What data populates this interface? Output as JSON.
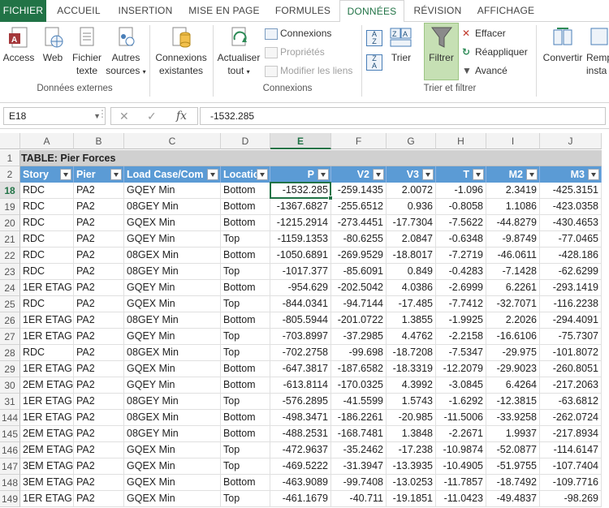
{
  "tabs": [
    "FICHIER",
    "ACCUEIL",
    "INSERTION",
    "MISE EN PAGE",
    "FORMULES",
    "DONNÉES",
    "RÉVISION",
    "AFFICHAGE"
  ],
  "ribbon": {
    "access": "Access",
    "web": "Web",
    "fichier_texte_1": "Fichier",
    "fichier_texte_2": "texte",
    "autres_sources_1": "Autres",
    "autres_sources_2": "sources",
    "group_donnees_externes": "Données externes",
    "connexions_existantes_1": "Connexions",
    "connexions_existantes_2": "existantes",
    "actualiser_1": "Actualiser",
    "actualiser_2": "tout",
    "connexions": "Connexions",
    "proprietes": "Propriétés",
    "modifier_liens": "Modifier les liens",
    "group_connexions": "Connexions",
    "trier": "Trier",
    "filtrer": "Filtrer",
    "effacer": "Effacer",
    "reappliquer": "Réappliquer",
    "avance": "Avancé",
    "group_trier_filtrer": "Trier et filtrer",
    "convertir": "Convertir",
    "remplissage_1": "Remp",
    "remplissage_2": "insta"
  },
  "formula_bar": {
    "name_box": "E18",
    "formula": "-1532.285"
  },
  "columns": [
    "A",
    "B",
    "C",
    "D",
    "E",
    "F",
    "G",
    "H",
    "I",
    "J"
  ],
  "table_title": "TABLE:  Pier Forces",
  "table_headers": [
    "Story",
    "Pier",
    "Load Case/Com",
    "Locatio",
    "P",
    "V2",
    "V3",
    "T",
    "M2",
    "M3"
  ],
  "rows": [
    {
      "n": "1"
    },
    {
      "n": "2"
    },
    {
      "n": "18",
      "cells": [
        "RDC",
        "PA2",
        "GQEY Min",
        "Bottom",
        "-1532.285",
        "-259.1435",
        "2.0072",
        "-1.096",
        "2.3419",
        "-425.3151"
      ]
    },
    {
      "n": "19",
      "cells": [
        "RDC",
        "PA2",
        "08GEY Min",
        "Bottom",
        "-1367.6827",
        "-255.6512",
        "0.936",
        "-0.8058",
        "1.1086",
        "-423.0358"
      ]
    },
    {
      "n": "20",
      "cells": [
        "RDC",
        "PA2",
        "GQEX Min",
        "Bottom",
        "-1215.2914",
        "-273.4451",
        "-17.7304",
        "-7.5622",
        "-44.8279",
        "-430.4653"
      ]
    },
    {
      "n": "21",
      "cells": [
        "RDC",
        "PA2",
        "GQEY Min",
        "Top",
        "-1159.1353",
        "-80.6255",
        "2.0847",
        "-0.6348",
        "-9.8749",
        "-77.0465"
      ]
    },
    {
      "n": "22",
      "cells": [
        "RDC",
        "PA2",
        "08GEX Min",
        "Bottom",
        "-1050.6891",
        "-269.9529",
        "-18.8017",
        "-7.2719",
        "-46.0611",
        "-428.186"
      ]
    },
    {
      "n": "23",
      "cells": [
        "RDC",
        "PA2",
        "08GEY Min",
        "Top",
        "-1017.377",
        "-85.6091",
        "0.849",
        "-0.4283",
        "-7.1428",
        "-62.6299"
      ]
    },
    {
      "n": "24",
      "cells": [
        "1ER ETAG",
        "PA2",
        "GQEY Min",
        "Bottom",
        "-954.629",
        "-202.5042",
        "4.0386",
        "-2.6999",
        "6.2261",
        "-293.1419"
      ]
    },
    {
      "n": "25",
      "cells": [
        "RDC",
        "PA2",
        "GQEX Min",
        "Top",
        "-844.0341",
        "-94.7144",
        "-17.485",
        "-7.7412",
        "-32.7071",
        "-116.2238"
      ]
    },
    {
      "n": "26",
      "cells": [
        "1ER ETAG",
        "PA2",
        "08GEY Min",
        "Bottom",
        "-805.5944",
        "-201.0722",
        "1.3855",
        "-1.9925",
        "2.2026",
        "-294.4091"
      ]
    },
    {
      "n": "27",
      "cells": [
        "1ER ETAG",
        "PA2",
        "GQEY Min",
        "Top",
        "-703.8997",
        "-37.2985",
        "4.4762",
        "-2.2158",
        "-16.6106",
        "-75.7307"
      ]
    },
    {
      "n": "28",
      "cells": [
        "RDC",
        "PA2",
        "08GEX Min",
        "Top",
        "-702.2758",
        "-99.698",
        "-18.7208",
        "-7.5347",
        "-29.975",
        "-101.8072"
      ]
    },
    {
      "n": "29",
      "cells": [
        "1ER ETAG",
        "PA2",
        "GQEX Min",
        "Bottom",
        "-647.3817",
        "-187.6582",
        "-18.3319",
        "-12.2079",
        "-29.9023",
        "-260.8051"
      ]
    },
    {
      "n": "30",
      "cells": [
        "2EM ETAG",
        "PA2",
        "GQEY Min",
        "Bottom",
        "-613.8114",
        "-170.0325",
        "4.3992",
        "-3.0845",
        "6.4264",
        "-217.2063"
      ]
    },
    {
      "n": "31",
      "cells": [
        "1ER ETAG",
        "PA2",
        "08GEY Min",
        "Top",
        "-576.2895",
        "-41.5599",
        "1.5743",
        "-1.6292",
        "-12.3815",
        "-63.6812"
      ]
    },
    {
      "n": "144",
      "cells": [
        "1ER ETAG",
        "PA2",
        "08GEX Min",
        "Bottom",
        "-498.3471",
        "-186.2261",
        "-20.985",
        "-11.5006",
        "-33.9258",
        "-262.0724"
      ]
    },
    {
      "n": "145",
      "cells": [
        "2EM ETAG",
        "PA2",
        "08GEY Min",
        "Bottom",
        "-488.2531",
        "-168.7481",
        "1.3848",
        "-2.2671",
        "1.9937",
        "-217.8934"
      ]
    },
    {
      "n": "146",
      "cells": [
        "2EM ETAG",
        "PA2",
        "GQEX Min",
        "Top",
        "-472.9637",
        "-35.2462",
        "-17.238",
        "-10.9874",
        "-52.0877",
        "-114.6147"
      ]
    },
    {
      "n": "147",
      "cells": [
        "3EM ETAG",
        "PA2",
        "GQEX Min",
        "Top",
        "-469.5222",
        "-31.3947",
        "-13.3935",
        "-10.4905",
        "-51.9755",
        "-107.7404"
      ]
    },
    {
      "n": "148",
      "cells": [
        "3EM ETAG",
        "PA2",
        "GQEX Min",
        "Bottom",
        "-463.9089",
        "-99.7408",
        "-13.0253",
        "-11.7857",
        "-18.7492",
        "-109.7716"
      ]
    },
    {
      "n": "149",
      "cells": [
        "1ER ETAG",
        "PA2",
        "GQEX Min",
        "Top",
        "-461.1679",
        "-40.711",
        "-19.1851",
        "-11.0423",
        "-49.4837",
        "-98.269"
      ]
    }
  ],
  "colors": {
    "excel_green": "#217346",
    "header_blue": "#5b9bd5",
    "title_gray": "#d0d0d0",
    "filter_active": "#c6e0b4"
  }
}
